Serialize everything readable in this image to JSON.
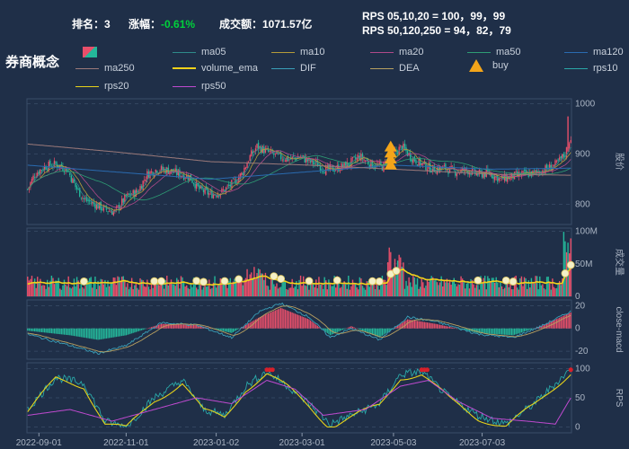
{
  "header": {
    "rank_label": "排名：3",
    "change_label": "涨幅：",
    "change_value": "-0.61%",
    "turnover_label": "成交额：1071.57亿"
  },
  "rps_lines": [
    "RPS 05,10,20 = 100，99，99",
    "RPS 50,120,250 = 94，82，79"
  ],
  "title": "券商概念",
  "legend": [
    {
      "label": "ma05",
      "color": "#2e8b8b"
    },
    {
      "label": "ma10",
      "color": "#b59c3a"
    },
    {
      "label": "ma20",
      "color": "#b04a8a"
    },
    {
      "label": "ma50",
      "color": "#2e9d74"
    },
    {
      "label": "ma120",
      "color": "#2a6bb0"
    },
    {
      "label": "ma250",
      "color": "#9c7a7a"
    },
    {
      "label": "volume_ema",
      "color": "#f3d21a"
    },
    {
      "label": "DIF",
      "color": "#3a9fb8"
    },
    {
      "label": "DEA",
      "color": "#b8a060"
    },
    {
      "label": "buy",
      "color": "#f3a51a"
    },
    {
      "label": "rps10",
      "color": "#2aa8a8"
    },
    {
      "label": "rps20",
      "color": "#e6d21a"
    },
    {
      "label": "rps50",
      "color": "#c04ad0"
    }
  ],
  "colors": {
    "up": "#e84f6a",
    "down": "#24b79a",
    "grid": "#3a4d68",
    "axis": "#8a98ab"
  },
  "chart_data": {
    "type": "candlestick",
    "x_ticks": [
      "2022-09-01",
      "2022-11-01",
      "2023-01-02",
      "2023-03-01",
      "2023-05-03",
      "2023-07-03"
    ],
    "price_axis": {
      "label": "股价",
      "ticks": [
        800,
        900,
        1000
      ],
      "range": [
        760,
        1010
      ]
    },
    "volume_axis": {
      "label": "成交量",
      "ticks": [
        "0",
        "50M",
        "100M"
      ],
      "range": [
        0,
        105
      ]
    },
    "macd_axis": {
      "label": "close-macd",
      "ticks": [
        -20,
        0,
        20
      ],
      "range": [
        -27,
        25
      ]
    },
    "rps_axis": {
      "label": "RPS",
      "ticks": [
        0,
        50,
        100
      ],
      "range": [
        -10,
        110
      ]
    },
    "price_anchors": [
      [
        0,
        830
      ],
      [
        5,
        860
      ],
      [
        12,
        875
      ],
      [
        20,
        880
      ],
      [
        28,
        870
      ],
      [
        34,
        835
      ],
      [
        40,
        810
      ],
      [
        48,
        800
      ],
      [
        55,
        790
      ],
      [
        62,
        785
      ],
      [
        70,
        815
      ],
      [
        78,
        825
      ],
      [
        85,
        860
      ],
      [
        92,
        870
      ],
      [
        100,
        868
      ],
      [
        108,
        860
      ],
      [
        115,
        855
      ],
      [
        122,
        830
      ],
      [
        130,
        820
      ],
      [
        138,
        825
      ],
      [
        145,
        840
      ],
      [
        152,
        860
      ],
      [
        158,
        895
      ],
      [
        163,
        915
      ],
      [
        170,
        905
      ],
      [
        178,
        895
      ],
      [
        186,
        890
      ],
      [
        194,
        895
      ],
      [
        200,
        885
      ],
      [
        206,
        880
      ],
      [
        212,
        868
      ],
      [
        220,
        872
      ],
      [
        228,
        880
      ],
      [
        236,
        895
      ],
      [
        244,
        880
      ],
      [
        252,
        875
      ],
      [
        260,
        900
      ],
      [
        266,
        915
      ],
      [
        272,
        895
      ],
      [
        280,
        880
      ],
      [
        288,
        870
      ],
      [
        296,
        872
      ],
      [
        304,
        865
      ],
      [
        312,
        868
      ],
      [
        320,
        860
      ],
      [
        328,
        862
      ],
      [
        336,
        850
      ],
      [
        344,
        855
      ],
      [
        352,
        860
      ],
      [
        360,
        862
      ],
      [
        368,
        870
      ],
      [
        376,
        880
      ],
      [
        382,
        900
      ],
      [
        386,
        935
      ]
    ],
    "ma250_anchors": [
      [
        0,
        920
      ],
      [
        60,
        905
      ],
      [
        130,
        885
      ],
      [
        200,
        878
      ],
      [
        260,
        870
      ],
      [
        330,
        860
      ],
      [
        386,
        858
      ]
    ],
    "ma120_anchors": [
      [
        0,
        878
      ],
      [
        60,
        865
      ],
      [
        130,
        850
      ],
      [
        200,
        865
      ],
      [
        260,
        878
      ],
      [
        330,
        870
      ],
      [
        386,
        872
      ]
    ],
    "macd_points": [
      [
        0,
        -2
      ],
      [
        30,
        -6
      ],
      [
        50,
        -10
      ],
      [
        70,
        -6
      ],
      [
        95,
        4
      ],
      [
        120,
        3
      ],
      [
        145,
        -4
      ],
      [
        165,
        10
      ],
      [
        180,
        18
      ],
      [
        200,
        8
      ],
      [
        215,
        -6
      ],
      [
        230,
        2
      ],
      [
        250,
        -8
      ],
      [
        270,
        8
      ],
      [
        290,
        4
      ],
      [
        320,
        -4
      ],
      [
        345,
        -6
      ],
      [
        365,
        2
      ],
      [
        386,
        14
      ]
    ],
    "dif_points": [
      [
        0,
        -5
      ],
      [
        30,
        -15
      ],
      [
        50,
        -22
      ],
      [
        70,
        -15
      ],
      [
        95,
        5
      ],
      [
        120,
        3
      ],
      [
        145,
        -8
      ],
      [
        165,
        15
      ],
      [
        180,
        22
      ],
      [
        200,
        10
      ],
      [
        215,
        -8
      ],
      [
        230,
        0
      ],
      [
        250,
        -10
      ],
      [
        270,
        10
      ],
      [
        290,
        6
      ],
      [
        320,
        -5
      ],
      [
        345,
        -8
      ],
      [
        365,
        2
      ],
      [
        386,
        15
      ]
    ],
    "rps_points": [
      [
        0,
        30
      ],
      [
        20,
        85
      ],
      [
        40,
        75
      ],
      [
        55,
        10
      ],
      [
        70,
        0
      ],
      [
        90,
        50
      ],
      [
        110,
        80
      ],
      [
        125,
        30
      ],
      [
        140,
        20
      ],
      [
        155,
        70
      ],
      [
        170,
        95
      ],
      [
        185,
        70
      ],
      [
        200,
        40
      ],
      [
        215,
        5
      ],
      [
        230,
        20
      ],
      [
        250,
        40
      ],
      [
        265,
        90
      ],
      [
        280,
        95
      ],
      [
        300,
        50
      ],
      [
        320,
        20
      ],
      [
        340,
        5
      ],
      [
        360,
        40
      ],
      [
        386,
        99
      ]
    ],
    "rps50_points": [
      [
        0,
        20
      ],
      [
        30,
        30
      ],
      [
        60,
        10
      ],
      [
        90,
        30
      ],
      [
        120,
        50
      ],
      [
        145,
        40
      ],
      [
        170,
        80
      ],
      [
        190,
        65
      ],
      [
        210,
        20
      ],
      [
        240,
        30
      ],
      [
        265,
        70
      ],
      [
        285,
        80
      ],
      [
        305,
        45
      ],
      [
        330,
        15
      ],
      [
        355,
        10
      ],
      [
        375,
        5
      ],
      [
        386,
        50
      ]
    ]
  }
}
